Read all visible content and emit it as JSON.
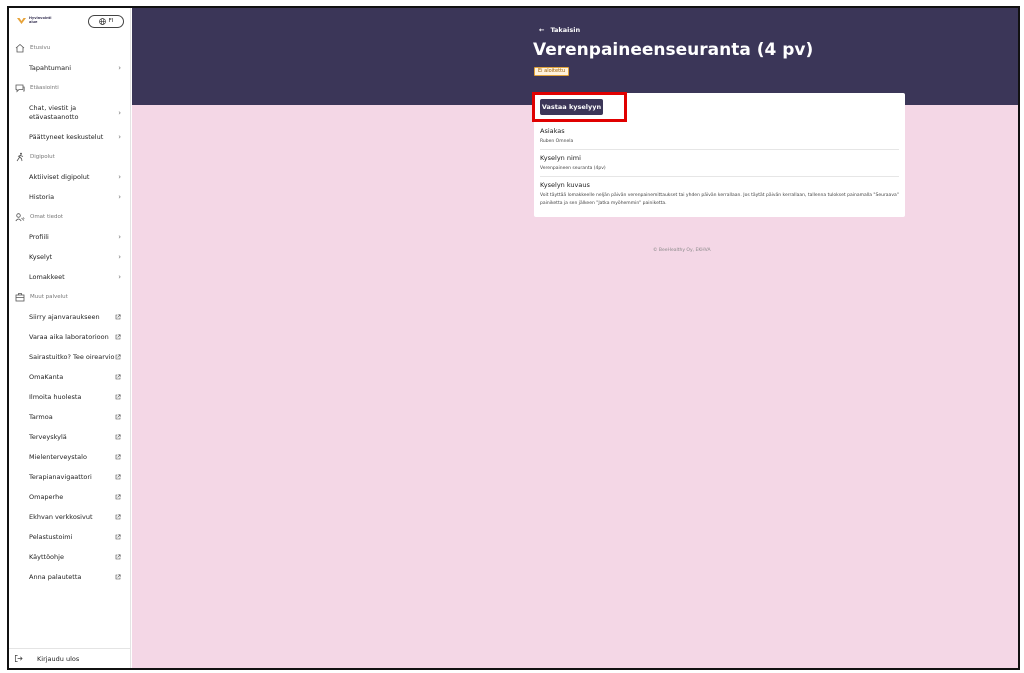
{
  "sidebar": {
    "logo_line1": "Hyvinvointi",
    "logo_line2": "alue",
    "lang": "FI",
    "sections": [
      {
        "label": "Etusivu",
        "icon": "home-icon",
        "items": [
          {
            "label": "Tapahtumani",
            "type": "chevron"
          }
        ]
      },
      {
        "label": "Etäasiointi",
        "icon": "chat-icon",
        "items": [
          {
            "label": "Chat, viestit ja etävastaanotto",
            "type": "chevron"
          },
          {
            "label": "Päättyneet keskustelut",
            "type": "chevron"
          }
        ]
      },
      {
        "label": "Digipolut",
        "icon": "walk-icon",
        "items": [
          {
            "label": "Aktiiviset digipolut",
            "type": "chevron"
          },
          {
            "label": "Historia",
            "type": "chevron"
          }
        ]
      },
      {
        "label": "Omat tiedot",
        "icon": "user-icon",
        "items": [
          {
            "label": "Profiili",
            "type": "chevron"
          },
          {
            "label": "Kyselyt",
            "type": "chevron"
          },
          {
            "label": "Lomakkeet",
            "type": "chevron"
          }
        ]
      },
      {
        "label": "Muut palvelut",
        "icon": "services-icon",
        "items": [
          {
            "label": "Siirry ajanvaraukseen",
            "type": "external"
          },
          {
            "label": "Varaa aika laboratorioon",
            "type": "external"
          },
          {
            "label": "Sairastuitko? Tee oirearvio",
            "type": "external"
          },
          {
            "label": "OmaKanta",
            "type": "external"
          },
          {
            "label": "Ilmoita huolesta",
            "type": "external"
          },
          {
            "label": "Tarmoa",
            "type": "external"
          },
          {
            "label": "Terveyskylä",
            "type": "external"
          },
          {
            "label": "Mielenterveystalo",
            "type": "external"
          },
          {
            "label": "Terapianavigaattori",
            "type": "external"
          },
          {
            "label": "Omaperhe",
            "type": "external"
          },
          {
            "label": "Ekhvan verkkosivut",
            "type": "external"
          },
          {
            "label": "Pelastustoimi",
            "type": "external"
          },
          {
            "label": "Käyttöohje",
            "type": "external"
          },
          {
            "label": "Anna palautetta",
            "type": "external"
          }
        ]
      }
    ],
    "logout": "Kirjaudu ulos"
  },
  "header": {
    "back": "Takaisin",
    "title": "Verenpaineenseuranta (4 pv)",
    "status": "Ei aloitettu"
  },
  "card": {
    "answer_button": "Vastaa kyselyyn",
    "fields": [
      {
        "label": "Asiakas",
        "value": "Ruben Omnela"
      },
      {
        "label": "Kyselyn nimi",
        "value": "Verenpaineen seuranta (4pv)"
      },
      {
        "label": "Kyselyn kuvaus",
        "value": "Voit täyttää lomakkeelle neljän päivän verenpainemittaukset tai yhden päivän kerrallaan. Jos täytät päivän kerrallaan, tallenna tulokset painamalla \"Seuraava\" painiketta ja sen jälkeen \"Jatka myöhemmin\" painiketta."
      }
    ]
  },
  "footer": "© BeeHealthy Oy, EKHVA",
  "colors": {
    "header_bg": "#3b3658",
    "page_bg": "#f4d7e6",
    "highlight": "#e00000"
  }
}
